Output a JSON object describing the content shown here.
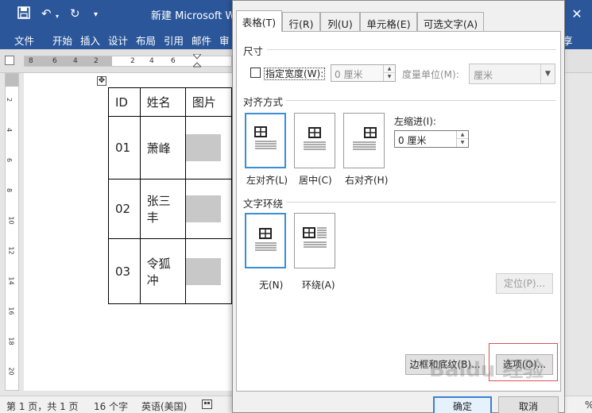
{
  "window": {
    "title": "新建 Microsoft W",
    "ribbon_tabs": [
      "文件",
      "开始",
      "插入",
      "设计",
      "布局",
      "引用",
      "邮件",
      "审"
    ],
    "ribbon_right": "享"
  },
  "ruler": {
    "horizontal_numbers": [
      "8",
      "6",
      "4",
      "2",
      "2",
      "4",
      "6"
    ],
    "vertical_numbers": [
      "2",
      "4",
      "6",
      "8",
      "10",
      "12",
      "14",
      "16",
      "18",
      "20"
    ]
  },
  "document_table": {
    "headers": [
      "ID",
      "姓名",
      "图片"
    ],
    "rows": [
      {
        "id": "01",
        "name": "萧峰"
      },
      {
        "id": "02",
        "name": "张三丰"
      },
      {
        "id": "03",
        "name": "令狐冲"
      }
    ]
  },
  "statusbar": {
    "page": "第 1 页，共 1 页",
    "words": "16 个字",
    "language": "英语(美国)",
    "zoom_fragment": "%"
  },
  "dialog": {
    "tabs": [
      "表格(T)",
      "行(R)",
      "列(U)",
      "单元格(E)",
      "可选文字(A)"
    ],
    "active_tab": "表格(T)",
    "size_section": "尺寸",
    "preferred_width_label": "指定宽度(W):",
    "preferred_width_value": "0 厘米",
    "measure_in_label": "度量单位(M):",
    "measure_in_value": "厘米",
    "alignment_section": "对齐方式",
    "alignment_options": [
      "左对齐(L)",
      "居中(C)",
      "右对齐(H)"
    ],
    "indent_label": "左缩进(I):",
    "indent_value": "0 厘米",
    "wrapping_section": "文字环绕",
    "wrapping_options": [
      "无(N)",
      "环绕(A)"
    ],
    "positioning_button": "定位(P)...",
    "borders_button": "边框和底纹(B)...",
    "options_button": "选项(O)...",
    "ok_button": "确定",
    "cancel_button": "取消"
  },
  "colors": {
    "word_blue": "#2b579a",
    "selection_blue": "#3a8fd6",
    "highlight_red": "#e05050"
  }
}
